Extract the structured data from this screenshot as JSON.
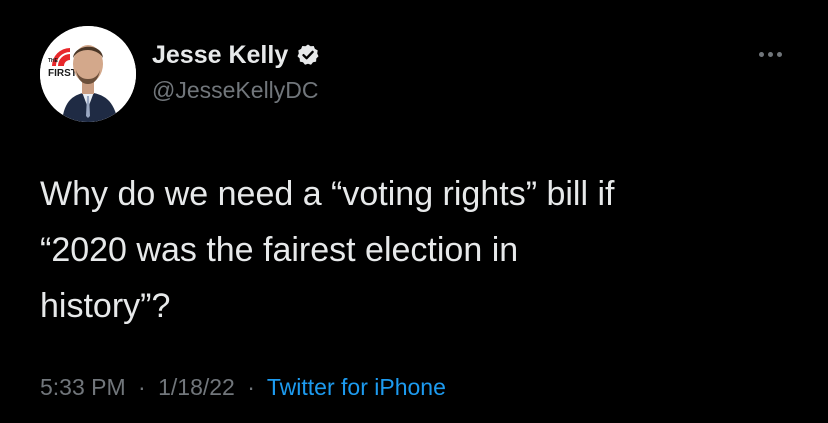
{
  "tweet": {
    "author": {
      "display_name": "Jesse Kelly",
      "handle": "@JesseKellyDC",
      "verified": true,
      "avatar_badge_text": "THE FIRST"
    },
    "text_lines": [
      "Why do we need a “voting rights” bill if",
      "“2020 was the fairest election in",
      "history”?"
    ],
    "meta": {
      "time": "5:33 PM",
      "separator": "·",
      "date": "1/18/22",
      "source": "Twitter for iPhone"
    },
    "icons": {
      "verified": "verified-badge-icon",
      "more": "more-horizontal-icon"
    },
    "colors": {
      "background": "#000000",
      "primary_text": "#e7e9ea",
      "secondary_text": "#71767b",
      "accent": "#1d9bf0",
      "badge_red": "#e8282b"
    }
  }
}
